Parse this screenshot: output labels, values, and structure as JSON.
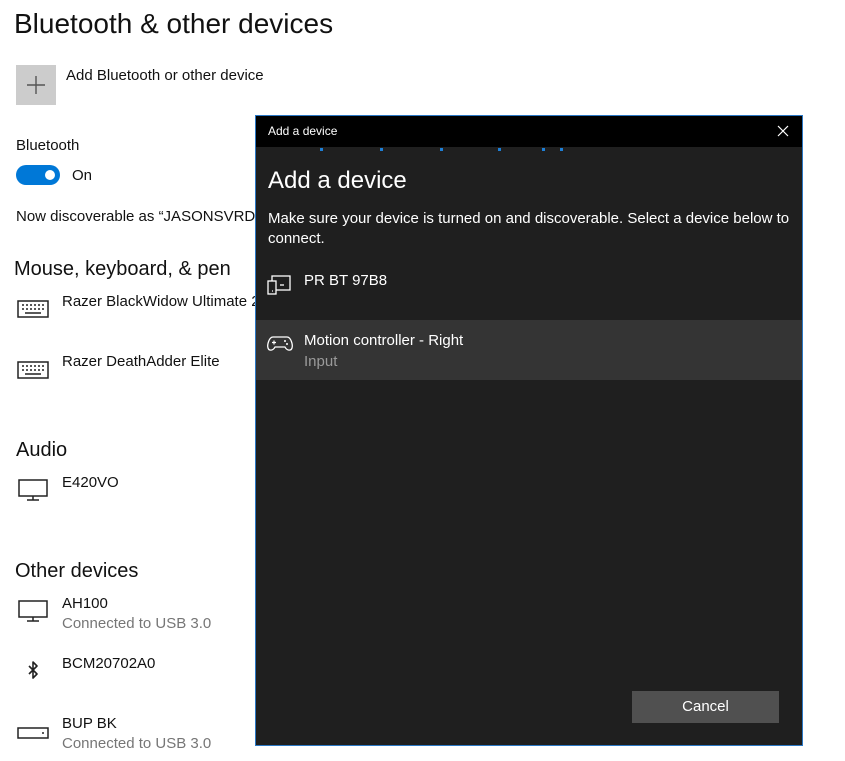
{
  "page": {
    "title": "Bluetooth & other devices",
    "add_device_label": "Add Bluetooth or other device",
    "bluetooth_label": "Bluetooth",
    "bluetooth_state": "On",
    "discoverable_text": "Now discoverable as “JASONSVRDESK”"
  },
  "sections": {
    "mouse_keyboard": {
      "heading": "Mouse, keyboard, & pen",
      "devices": [
        {
          "name": "Razer BlackWidow Ultimate 2",
          "icon": "keyboard-icon"
        },
        {
          "name": "Razer DeathAdder Elite",
          "icon": "keyboard-icon"
        }
      ]
    },
    "audio": {
      "heading": "Audio",
      "devices": [
        {
          "name": "E420VO",
          "icon": "monitor-icon"
        }
      ]
    },
    "other": {
      "heading": "Other devices",
      "devices": [
        {
          "name": "AH100",
          "status": "Connected to USB 3.0",
          "icon": "monitor-icon"
        },
        {
          "name": "BCM20702A0",
          "icon": "bluetooth-icon"
        },
        {
          "name": "BUP BK",
          "status": "Connected to USB 3.0",
          "icon": "drive-icon"
        }
      ]
    }
  },
  "dialog": {
    "window_title": "Add a device",
    "heading": "Add a device",
    "description": "Make sure your device is turned on and discoverable. Select a device below to connect.",
    "items": [
      {
        "name": "PR BT 97B8",
        "sub": "",
        "icon": "device-icon"
      },
      {
        "name": "Motion controller - Right",
        "sub": "Input",
        "icon": "gamepad-icon"
      }
    ],
    "cancel_label": "Cancel"
  },
  "colors": {
    "accent": "#0078d7",
    "dialog_bg": "#1f1f1f",
    "dialog_border": "#2b78c5"
  }
}
